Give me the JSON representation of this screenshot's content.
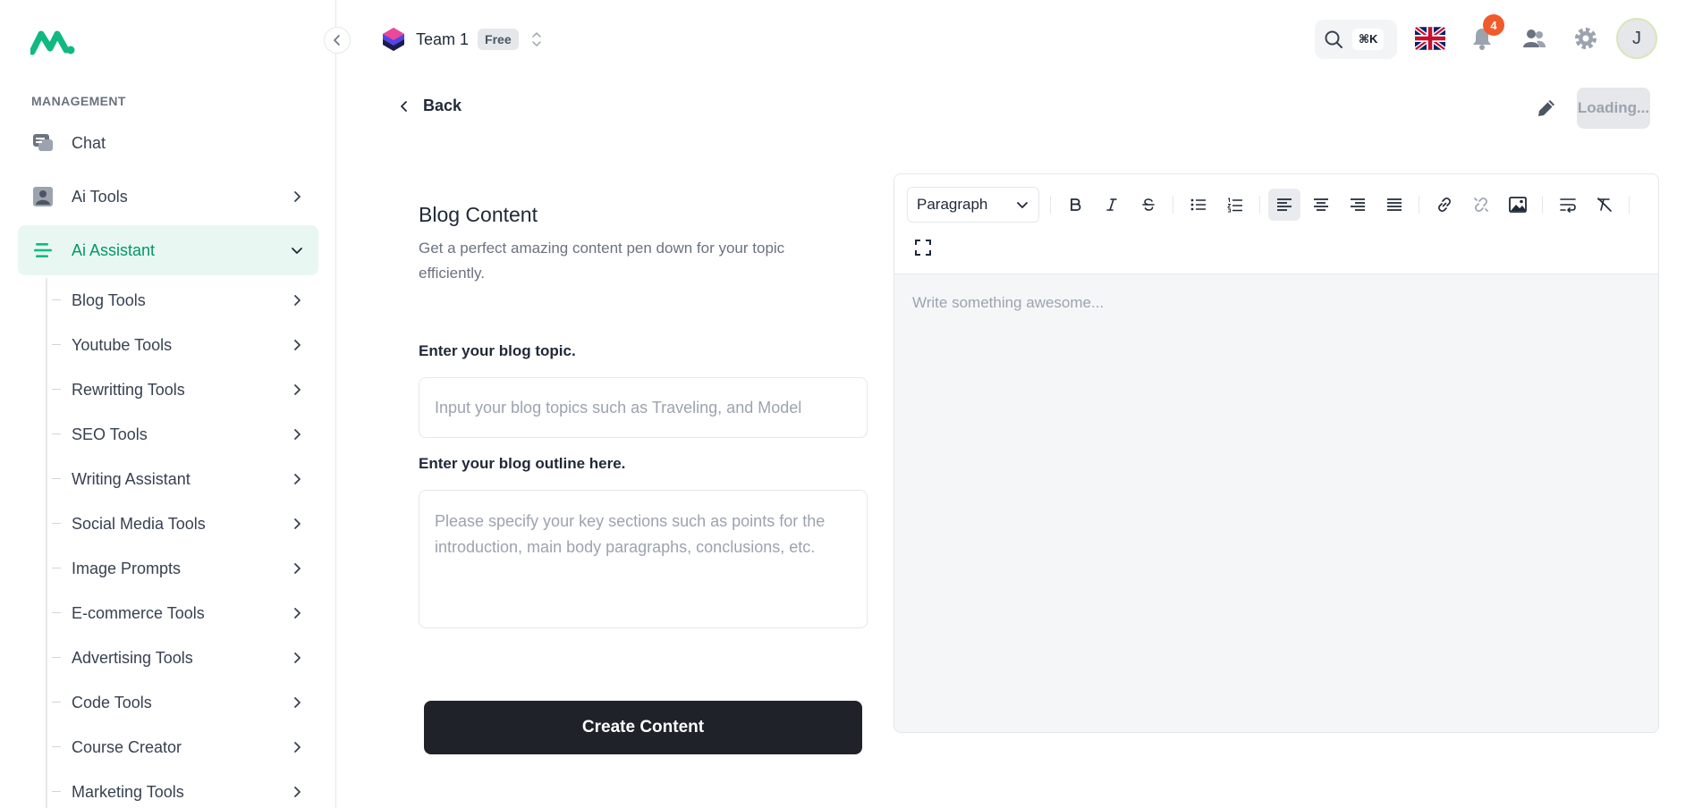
{
  "sidebar": {
    "section_label": "MANAGEMENT",
    "top_items": [
      {
        "label": "Chat",
        "icon": "chat-icon"
      },
      {
        "label": "Ai Tools",
        "icon": "user-card-icon"
      },
      {
        "label": "Ai Assistant",
        "icon": "menu-lines-icon",
        "active": true
      }
    ],
    "sub_items": [
      {
        "label": "Blog Tools"
      },
      {
        "label": "Youtube Tools"
      },
      {
        "label": "Rewritting Tools"
      },
      {
        "label": "SEO Tools"
      },
      {
        "label": "Writing Assistant"
      },
      {
        "label": "Social Media Tools"
      },
      {
        "label": "Image Prompts"
      },
      {
        "label": "E-commerce Tools"
      },
      {
        "label": "Advertising Tools"
      },
      {
        "label": "Code Tools"
      },
      {
        "label": "Course Creator"
      },
      {
        "label": "Marketing Tools"
      }
    ]
  },
  "header": {
    "team_name": "Team 1",
    "plan_badge": "Free",
    "search_shortcut": "⌘K",
    "notification_count": "4",
    "avatar_initial": "J"
  },
  "page": {
    "back_label": "Back",
    "loading_label": "Loading..."
  },
  "form": {
    "title": "Blog Content",
    "description": "Get a perfect amazing content pen down for your topic efficiently.",
    "topic_label": "Enter your blog topic.",
    "topic_placeholder": "Input your blog topics such as Traveling, and Model",
    "outline_label": "Enter your blog outline here.",
    "outline_placeholder": "Please specify your key sections such as points for the introduction, main body paragraphs, conclusions, etc.",
    "submit_label": "Create Content"
  },
  "editor": {
    "block_type": "Paragraph",
    "placeholder": "Write something awesome..."
  },
  "colors": {
    "accent": "#10b981",
    "active_bg": "#e8f7f1",
    "primary_button": "#1f2329",
    "notification": "#f15a2b"
  }
}
